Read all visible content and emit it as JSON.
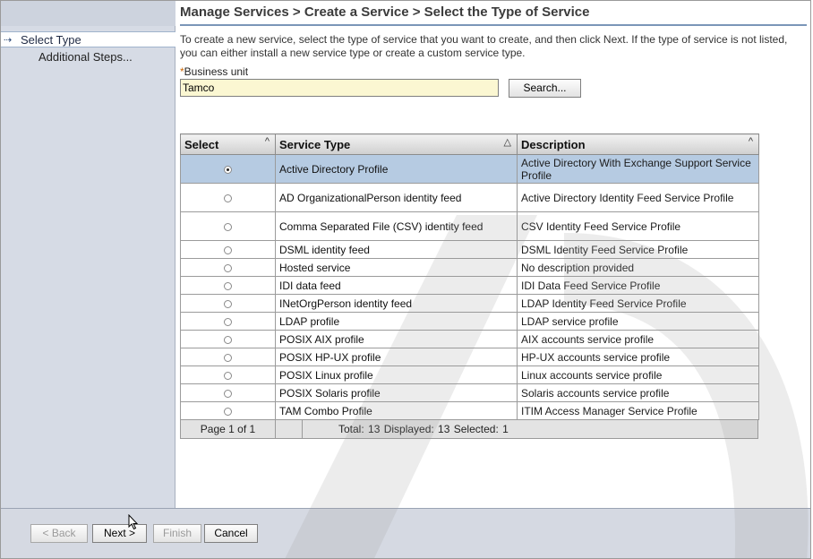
{
  "breadcrumb": "Manage Services > Create a Service > Select the Type of Service",
  "steps": {
    "current": "Select Type",
    "next": "Additional Steps..."
  },
  "intro": "To create a new service, select the type of service that you want to create, and then click Next. If the type of service is not listed, you can either install a new service type or create a custom service type.",
  "business_unit": {
    "required_marker": "*",
    "label": "Business unit",
    "value": "Tamco",
    "search_label": "Search..."
  },
  "table": {
    "headers": [
      "Select",
      "Service Type",
      "Description"
    ],
    "rows": [
      {
        "selected": true,
        "type": "Active Directory Profile",
        "description": "Active Directory With Exchange Support Service Profile"
      },
      {
        "selected": false,
        "type": "AD OrganizationalPerson identity feed",
        "description": "Active Directory Identity Feed Service Profile"
      },
      {
        "selected": false,
        "type": "Comma Separated File (CSV) identity feed",
        "description": "CSV Identity Feed Service Profile"
      },
      {
        "selected": false,
        "type": "DSML identity feed",
        "description": "DSML Identity Feed Service Profile"
      },
      {
        "selected": false,
        "type": "Hosted service",
        "description": "No description provided"
      },
      {
        "selected": false,
        "type": "IDI data feed",
        "description": "IDI Data Feed Service Profile"
      },
      {
        "selected": false,
        "type": "INetOrgPerson identity feed",
        "description": "LDAP Identity Feed Service Profile"
      },
      {
        "selected": false,
        "type": "LDAP profile",
        "description": "LDAP service profile"
      },
      {
        "selected": false,
        "type": "POSIX AIX profile",
        "description": "AIX accounts service profile"
      },
      {
        "selected": false,
        "type": "POSIX HP-UX profile",
        "description": "HP-UX accounts service profile"
      },
      {
        "selected": false,
        "type": "POSIX Linux profile",
        "description": "Linux accounts service profile"
      },
      {
        "selected": false,
        "type": "POSIX Solaris profile",
        "description": "Solaris accounts service profile"
      },
      {
        "selected": false,
        "type": "TAM Combo Profile",
        "description": "ITIM Access Manager Service Profile"
      }
    ],
    "pager": {
      "page": "Page 1 of 1",
      "summary": "Total: 13  Displayed: 13  Selected: 1"
    }
  },
  "buttons": {
    "back": "< Back",
    "next": "Next >",
    "finish": "Finish",
    "cancel": "Cancel"
  },
  "icons": {
    "step_arrow": "arrow-right-icon",
    "sort": "sort-icon",
    "cursor": "mouse-pointer-icon"
  }
}
